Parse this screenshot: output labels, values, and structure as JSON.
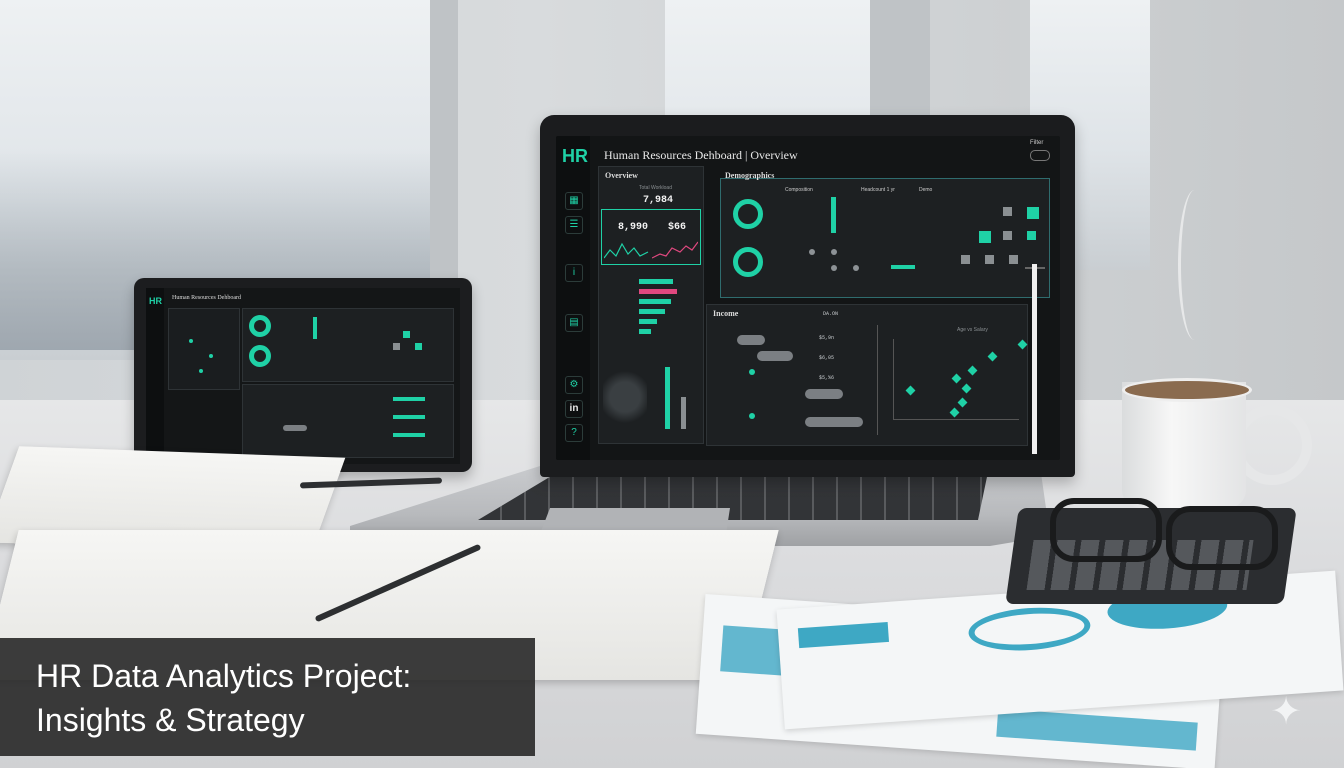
{
  "caption": {
    "line1": "HR Data Analytics Project:",
    "line2": "Insights & Strategy"
  },
  "laptop_dashboard": {
    "logo": "HR",
    "title": "Human Resources Dehboard | Overview",
    "filter_label": "Filter",
    "overview_label": "Overview",
    "overview_caption": "Total Workload",
    "kpi_total": "7,984",
    "kpi_left": "8,990",
    "kpi_right": "$66",
    "demographics_label": "Demographics",
    "section_labels": [
      "Composition",
      "Headcount 1 yr",
      "Demo"
    ],
    "lower_label": "Income",
    "lower_col_label": "DA.ON",
    "lower_values": [
      "$5,9n",
      "$6,05",
      "$5,%6"
    ],
    "scatter_label": "Age vs Salary",
    "linkedin_icon_text": "in",
    "colors": {
      "accent": "#1fd1a6",
      "accent_alt": "#e0487f",
      "panel": "#1d2022"
    }
  },
  "tablet_dashboard": {
    "title": "Human Resources Dehboard",
    "logo": "HR"
  }
}
